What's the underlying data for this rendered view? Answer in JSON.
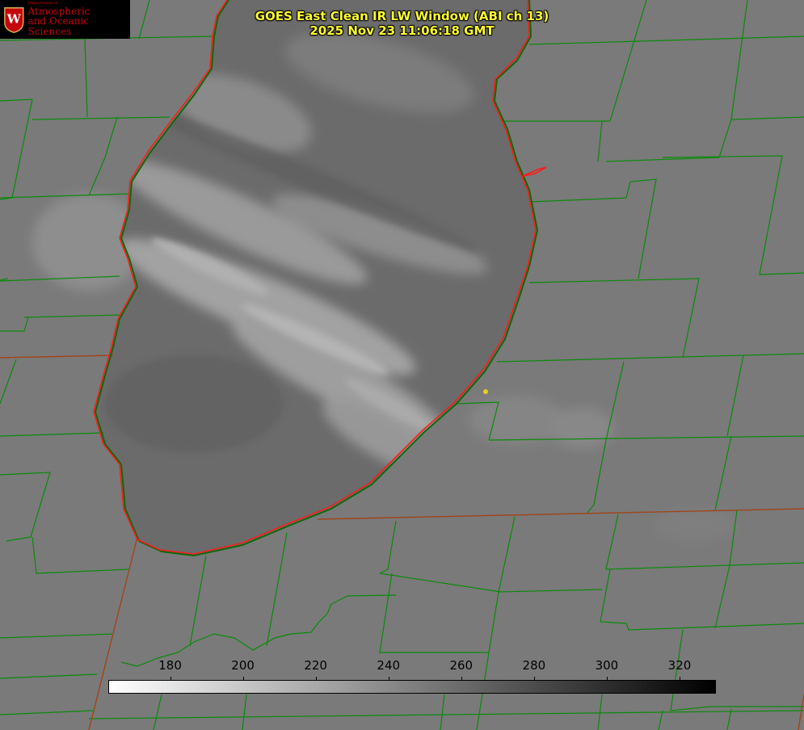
{
  "header": {
    "title_line1": "GOES East Clean IR LW Window (ABI ch 13)",
    "title_line2": "2025 Nov 23 11:06:18 GMT"
  },
  "logo": {
    "dept": "Department of",
    "name_line1": "Atmospheric",
    "name_line2": "and Oceanic Sciences",
    "seal_letter": "W",
    "seal_color": "#c5050c"
  },
  "colorbar": {
    "min": 163,
    "max": 330,
    "ticks": [
      "180",
      "200",
      "220",
      "240",
      "260",
      "280",
      "300",
      "320"
    ],
    "tick_values": [
      180,
      200,
      220,
      240,
      260,
      280,
      300,
      320
    ],
    "low_color": "#ffffff",
    "high_color": "#000000"
  },
  "colors": {
    "title": "#ffff2e",
    "county_lines": "#0a8a0a",
    "state_lines": "#a0451a",
    "lake_outline": "#ff1a1a",
    "land": "#7a7a7a",
    "lake": "#6a6a6a",
    "cloud": "#a8a8a8",
    "station_marker": "#e6d21a"
  }
}
